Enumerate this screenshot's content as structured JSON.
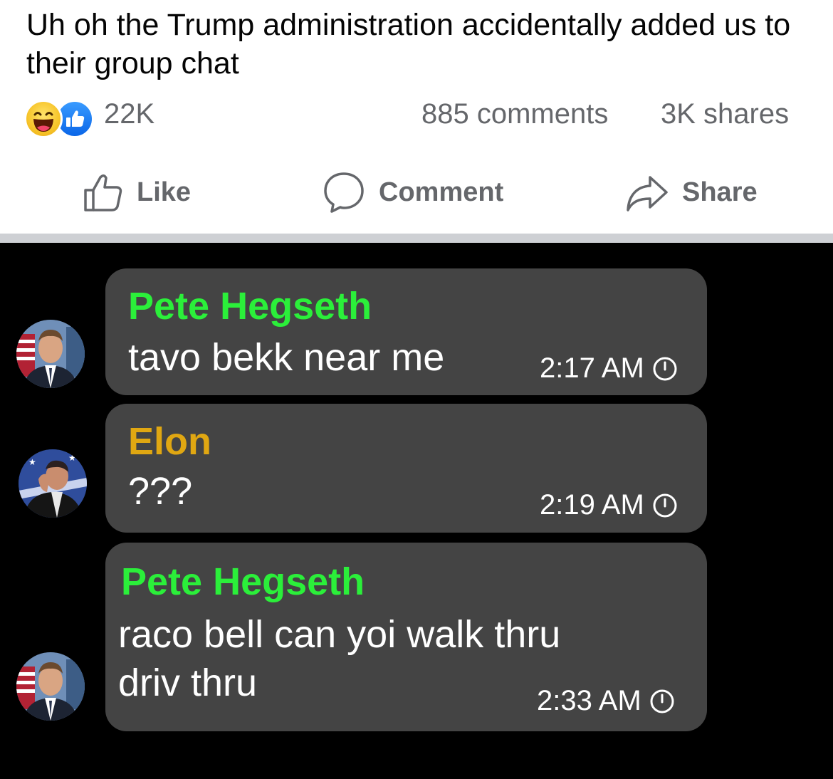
{
  "post": {
    "text": "Uh oh the Trump administration accidentally added us to their group chat",
    "reactions": [
      "haha-icon",
      "like-icon"
    ],
    "reaction_count": "22K",
    "comments": "885 comments",
    "shares": "3K shares",
    "actions": {
      "like": "Like",
      "comment": "Comment",
      "share": "Share"
    }
  },
  "chat": {
    "messages": [
      {
        "sender": "Pete Hegseth",
        "sender_color": "#2bef3a",
        "text": "tavo bekk near me",
        "time": "2:17 AM"
      },
      {
        "sender": "Elon",
        "sender_color": "#e0a712",
        "text": "???",
        "time": "2:19 AM"
      },
      {
        "sender": "Pete Hegseth",
        "sender_color": "#2bef3a",
        "text_lines": [
          "raco bell can yoi walk thru",
          "driv thru"
        ],
        "time": "2:33 AM"
      }
    ]
  }
}
